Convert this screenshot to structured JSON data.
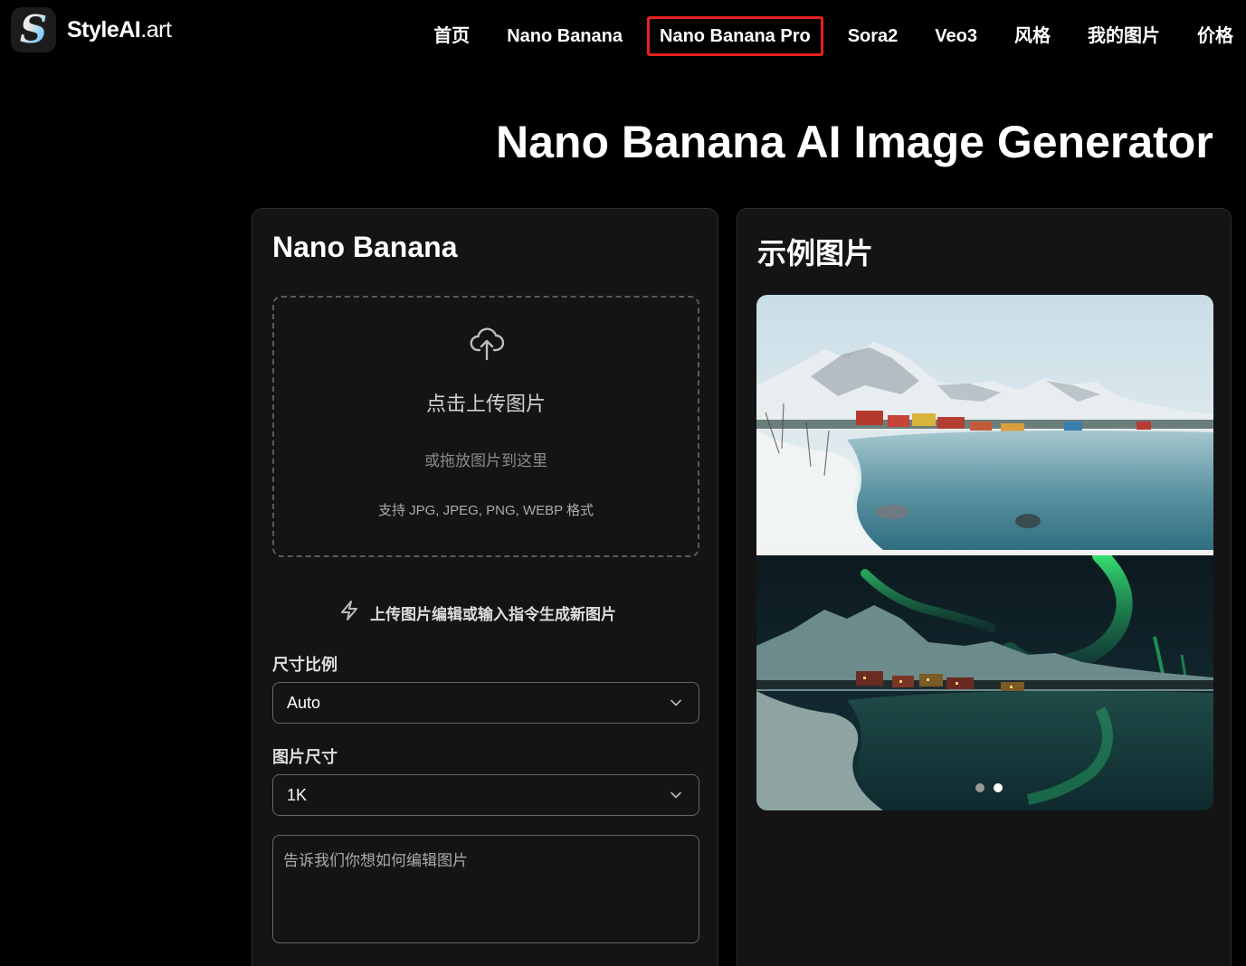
{
  "brand": {
    "name": "StyleAI",
    "tld": ".art",
    "logo_letter": "S"
  },
  "nav": {
    "items": [
      {
        "label": "首页"
      },
      {
        "label": "Nano Banana"
      },
      {
        "label": "Nano Banana Pro",
        "highlighted": true
      },
      {
        "label": "Sora2"
      },
      {
        "label": "Veo3"
      },
      {
        "label": "风格"
      },
      {
        "label": "我的图片"
      },
      {
        "label": "价格"
      }
    ]
  },
  "hero": {
    "title": "Nano Banana AI Image Generator"
  },
  "generator": {
    "title": "Nano Banana",
    "upload": {
      "icon": "cloud-upload-icon",
      "title": "点击上传图片",
      "subtitle": "或拖放图片到这里",
      "formats": "支持 JPG, JPEG, PNG, WEBP 格式"
    },
    "hint": {
      "icon": "lightning-icon",
      "text": "上传图片编辑或输入指令生成新图片"
    },
    "aspect_ratio": {
      "label": "尺寸比例",
      "value": "Auto"
    },
    "image_size": {
      "label": "图片尺寸",
      "value": "1K"
    },
    "prompt": {
      "placeholder": "告诉我们你想如何编辑图片"
    }
  },
  "examples": {
    "title": "示例图片",
    "images": [
      {
        "label": "snowy-lakeside-village-day"
      },
      {
        "label": "snowy-lakeside-village-aurora-night"
      }
    ],
    "carousel": {
      "total": 2,
      "active_index": 1
    }
  },
  "colors": {
    "highlight_border": "#e8201f",
    "background": "#000000",
    "panel": "#141414"
  }
}
